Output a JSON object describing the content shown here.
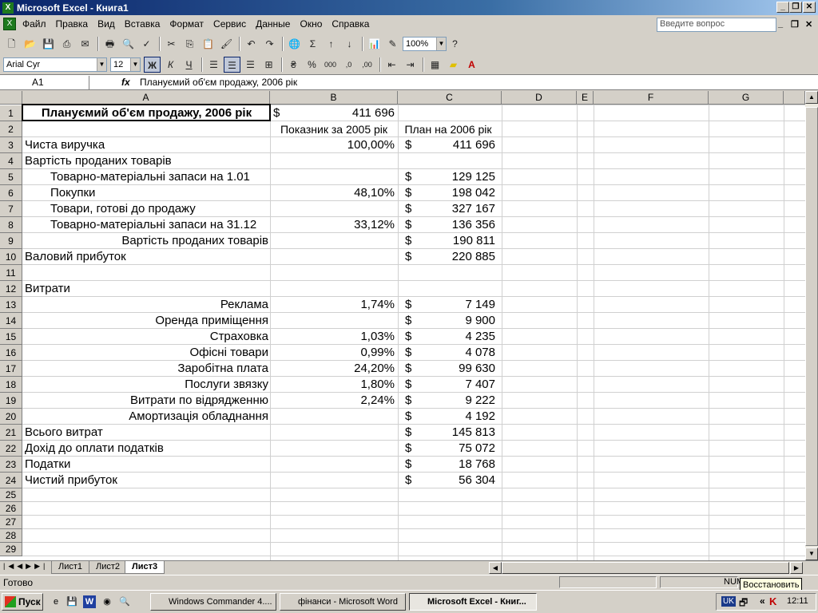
{
  "window": {
    "title": "Microsoft Excel - Книга1",
    "app_icon": "X"
  },
  "menu": [
    "Файл",
    "Правка",
    "Вид",
    "Вставка",
    "Формат",
    "Сервис",
    "Данные",
    "Окно",
    "Справка"
  ],
  "help_placeholder": "Введите вопрос",
  "toolbar": {
    "zoom": "100%",
    "font": "Arial Cyr",
    "size": "12"
  },
  "formula": {
    "cell": "A1",
    "fx": "fx",
    "value": "Плануємий об'єм продажу, 2006 рік"
  },
  "columns": [
    "A",
    "B",
    "C",
    "D",
    "E",
    "F",
    "G"
  ],
  "rows": [
    "1",
    "2",
    "3",
    "4",
    "5",
    "6",
    "7",
    "8",
    "9",
    "10",
    "11",
    "12",
    "13",
    "14",
    "15",
    "16",
    "17",
    "18",
    "19",
    "20",
    "21",
    "22",
    "23",
    "24",
    "25",
    "26",
    "27",
    "28",
    "29"
  ],
  "cells": {
    "a1": "Плануємий об'єм продажу, 2006 рік",
    "b1c": "$",
    "b1": "411 696",
    "b2": "Показник за 2005 рік",
    "c2": "План на 2006 рік",
    "a3": "Чиста виручка",
    "b3": "100,00%",
    "c3": "411 696",
    "a4": "Вартість проданих товарів",
    "a5": "Товарно-матеріальні запаси на 1.01",
    "c5": "129 125",
    "a6": "Покупки",
    "b6": "48,10%",
    "c6": "198 042",
    "a7": "Товари, готові до продажу",
    "c7": "327 167",
    "a8": "Товарно-матеріальні запаси на 31.12",
    "b8": "33,12%",
    "c8": "136 356",
    "a9": "Вартість проданих товарів",
    "c9": "190 811",
    "a10": "Валовий прибуток",
    "c10": "220 885",
    "a12": "Витрати",
    "a13": "Реклама",
    "b13": "1,74%",
    "c13": "7 149",
    "a14": "Оренда приміщення",
    "c14": "9 900",
    "a15": "Страховка",
    "b15": "1,03%",
    "c15": "4 235",
    "a16": "Офісні товари",
    "b16": "0,99%",
    "c16": "4 078",
    "a17": "Заробітна плата",
    "b17": "24,20%",
    "c17": "99 630",
    "a18": "Послуги звязку",
    "b18": "1,80%",
    "c18": "7 407",
    "a19": "Витрати по відрядженню",
    "b19": "2,24%",
    "c19": "9 222",
    "a20": "Амортизація обладнання",
    "c20": "4 192",
    "a21": "Всього витрат",
    "c21": "145 813",
    "a22": "Дохід до оплати податків",
    "c22": "75 072",
    "a23": "Податки",
    "c23": "18 768",
    "a24": "Чистий прибуток",
    "c24": "56 304",
    "dollar": "$"
  },
  "tabs": [
    "Лист1",
    "Лист2",
    "Лист3"
  ],
  "status": {
    "left": "Готово",
    "num": "NUM"
  },
  "tooltip": "Восстановить",
  "taskbar": {
    "start": "Пуск",
    "t1": "Windows Commander 4....",
    "t2": "фінанси - Microsoft Word",
    "t3": "Microsoft Excel - Книг...",
    "lang": "UK",
    "clock": "12:11"
  }
}
